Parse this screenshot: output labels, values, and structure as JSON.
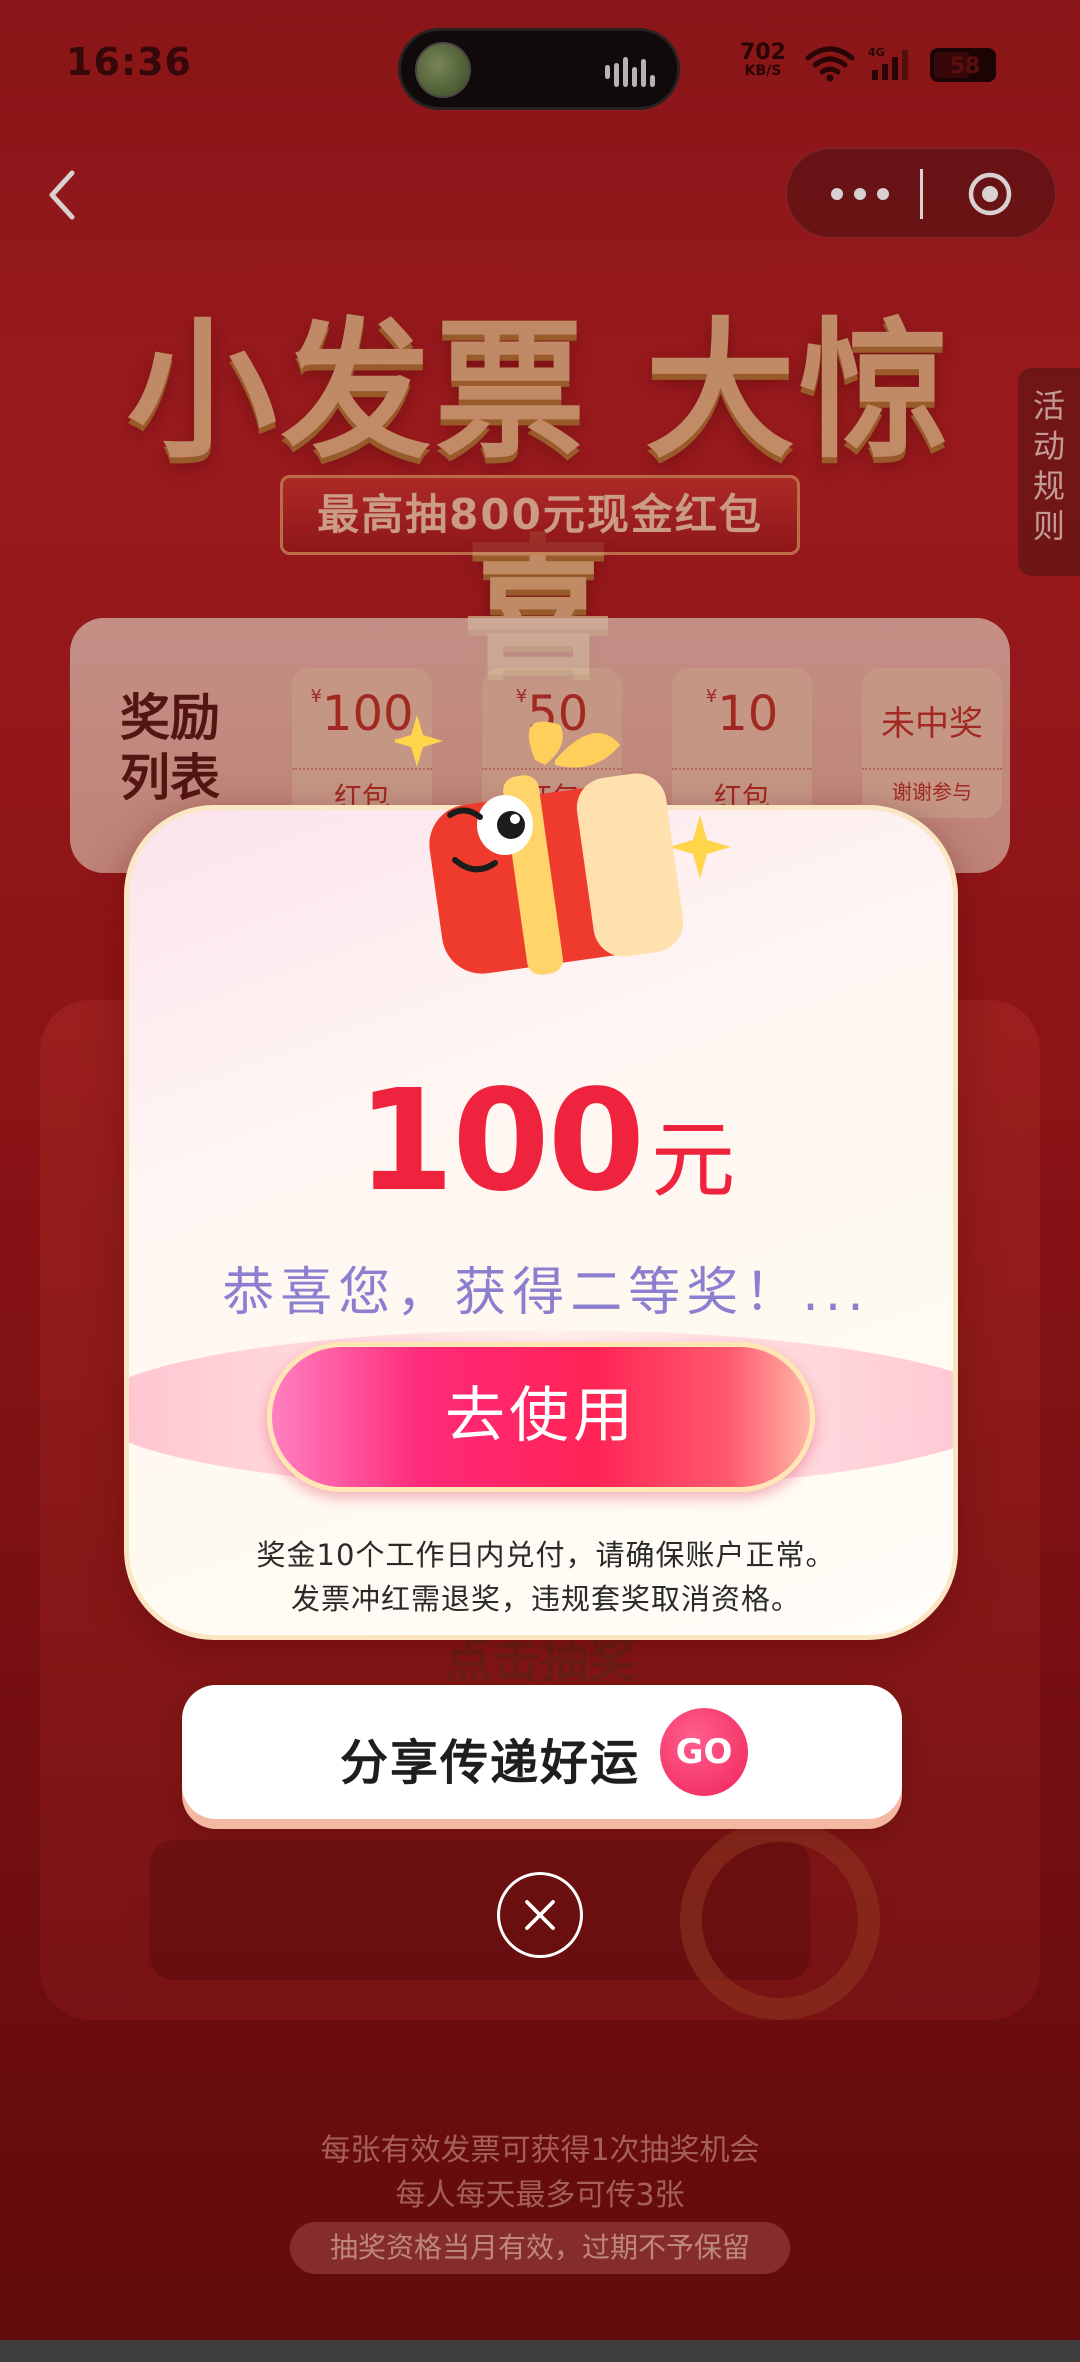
{
  "status_bar": {
    "time": "16:36",
    "net_speed": "702",
    "net_unit": "KB/S",
    "network_type": "4G",
    "battery": "58"
  },
  "nav": {
    "back_icon": "chevron-left-icon",
    "more_icon": "more-dots-icon",
    "close_icon": "close-circle-icon"
  },
  "hero": {
    "title": "小发票 大惊喜",
    "subtitle": "最高抽800元现金红包",
    "rules_tab": "活动规则"
  },
  "rewards": {
    "title": "奖励列表",
    "items": [
      {
        "currency": "¥",
        "amount": "100",
        "label": "红包"
      },
      {
        "currency": "¥",
        "amount": "50",
        "label": "红包"
      },
      {
        "currency": "¥",
        "amount": "10",
        "label": "红包"
      },
      {
        "currency": "",
        "amount": "未中奖",
        "label": "谢谢参与"
      }
    ]
  },
  "machine": {
    "draw_label": "点击抽奖"
  },
  "modal": {
    "prize_amount": "100",
    "prize_unit": "元",
    "congrats": "恭喜您，获得二等奖！...",
    "use_button": "去使用",
    "note_line1": "奖金10个工作日内兑付，请确保账户正常。",
    "note_line2": "发票冲红需退奖，违规套奖取消资格。"
  },
  "share": {
    "label": "分享传递好运",
    "badge": "GO"
  },
  "footer": {
    "line1": "每张有效发票可获得1次抽奖机会",
    "line2": "每人每天最多可传3张",
    "line3": "抽奖资格当月有效，过期不予保留"
  },
  "colors": {
    "brand_red": "#f0233f",
    "accent_pink": "#ff2a7a",
    "congrats_purple": "#8b7fcf",
    "background_red": "#a3191c"
  }
}
